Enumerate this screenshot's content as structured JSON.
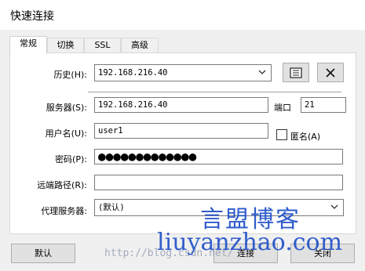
{
  "window": {
    "title": "快速连接"
  },
  "tabs": [
    {
      "label": "常规",
      "active": true
    },
    {
      "label": "切换",
      "active": false
    },
    {
      "label": "SSL",
      "active": false
    },
    {
      "label": "高级",
      "active": false
    }
  ],
  "form": {
    "history": {
      "label": "历史(H):",
      "value": "192.168.216.40"
    },
    "server": {
      "label": "服务器(S):",
      "value": "192.168.216.40"
    },
    "port": {
      "label": "端口",
      "value": "21"
    },
    "username": {
      "label": "用户名(U):",
      "value": "user1"
    },
    "anonymous": {
      "label": "匿名(A)",
      "checked": false
    },
    "password": {
      "label": "密码(P):",
      "value": "●●●●●●●●●●●●●"
    },
    "remote_path": {
      "label": "远端路径(R):",
      "value": ""
    },
    "proxy": {
      "label": "代理服务器:",
      "value": "(默认)"
    }
  },
  "icons": {
    "browse": "address-book-icon",
    "clear": "close-icon"
  },
  "buttons": {
    "default": "默认",
    "connect": "连接",
    "close": "关闭"
  },
  "watermark": {
    "title": "言盟博客",
    "domain": "liuyanzhao.com",
    "url": "http://blog.csdn.net/"
  },
  "colors": {
    "watermark": "#1e4fc8",
    "panel": "#ffffff",
    "background": "#f0f0f0"
  }
}
